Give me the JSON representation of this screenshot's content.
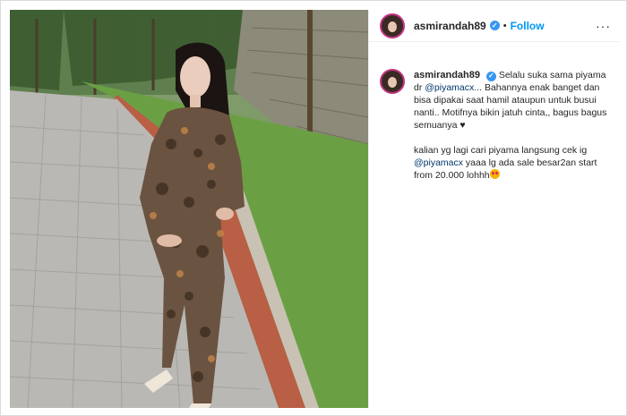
{
  "post": {
    "username": "asmirandah89",
    "separator": "•",
    "follow_label": "Follow",
    "more_label": "···",
    "caption": {
      "username": "asmirandah89",
      "line1_a": "Selalu suka sama piyama dr ",
      "mention1": "@piyamacx",
      "line1_b": "... Bahannya enak banget dan bisa dipakai saat hamil ataupun untuk busui nanti.. Motifnya bikin jatuh cinta,, bagus bagus semuanya ",
      "heart": "♥",
      "line2_a": "kalian yg lagi cari piyama langsung cek ig ",
      "mention2": "@piyamacx",
      "line2_b": " yaaa lg ada sale besar2an start from 20.000 lohhh"
    }
  },
  "icons": {
    "verified": "verified-badge-icon",
    "emoji": "heart-eyes-emoji"
  },
  "colors": {
    "follow": "#0095f6",
    "verified": "#3897f0",
    "mention": "#00376b"
  }
}
